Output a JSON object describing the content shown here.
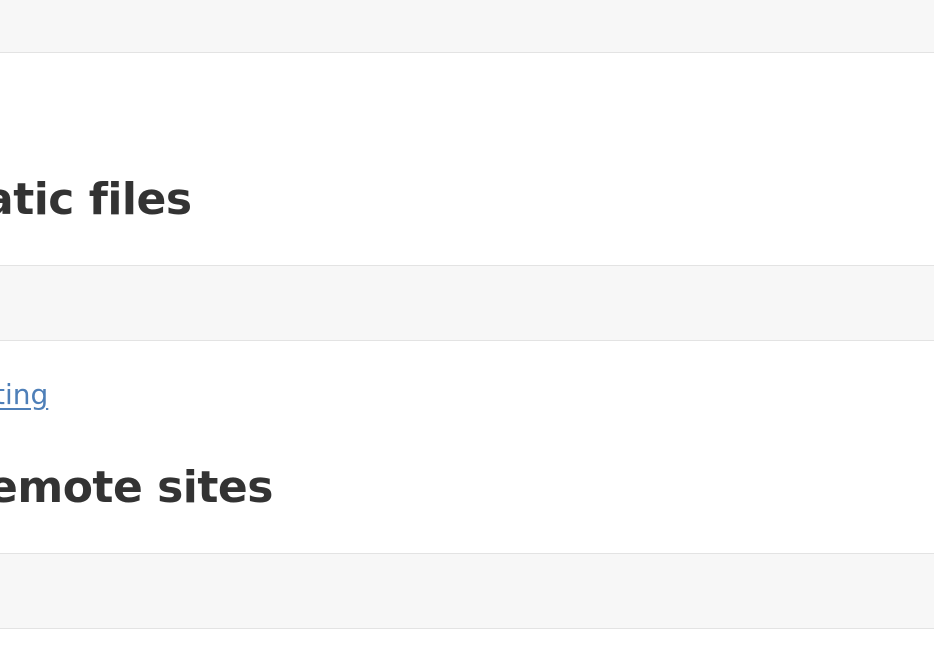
{
  "sections": [
    {
      "heading": "atic files"
    },
    {
      "link_text": "ting",
      "heading": "emote sites"
    }
  ]
}
